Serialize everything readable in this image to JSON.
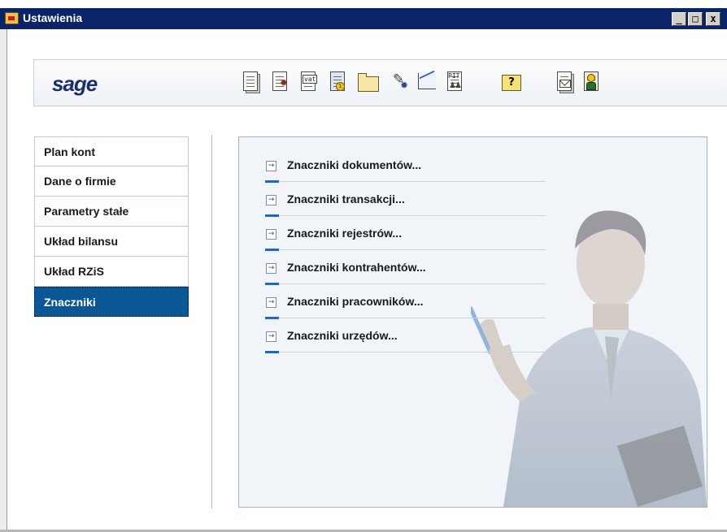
{
  "window": {
    "title": "Ustawienia",
    "controls": {
      "minimize": "_",
      "maximize": "□",
      "close": "x"
    }
  },
  "toolbar": {
    "logo": "sage",
    "icons": [
      "documents-icon",
      "document-settings-icon",
      "vat-icon",
      "payment-icon",
      "folder-icon",
      "tools-icon",
      "chart-icon",
      "pit-icon",
      "help-icon",
      "mail-icon",
      "user-icon"
    ],
    "vat_label": "vat",
    "pit_label": "PIT",
    "help_label": "?"
  },
  "nav": {
    "items": [
      {
        "label": "Plan kont",
        "active": false
      },
      {
        "label": "Dane o firmie",
        "active": false
      },
      {
        "label": "Parametry stałe",
        "active": false
      },
      {
        "label": "Układ bilansu",
        "active": false
      },
      {
        "label": "Układ RZiS",
        "active": false
      },
      {
        "label": "Znaczniki",
        "active": true
      }
    ]
  },
  "panel": {
    "links": [
      "Znaczniki dokumentów...",
      "Znaczniki transakcji...",
      "Znaczniki rejestrów...",
      "Znaczniki kontrahentów...",
      "Znaczniki pracowników...",
      "Znaczniki urzędów..."
    ]
  },
  "colors": {
    "titlebar": "#0a246a",
    "active_nav": "#0b5796",
    "link_accent": "#2a65b6"
  }
}
